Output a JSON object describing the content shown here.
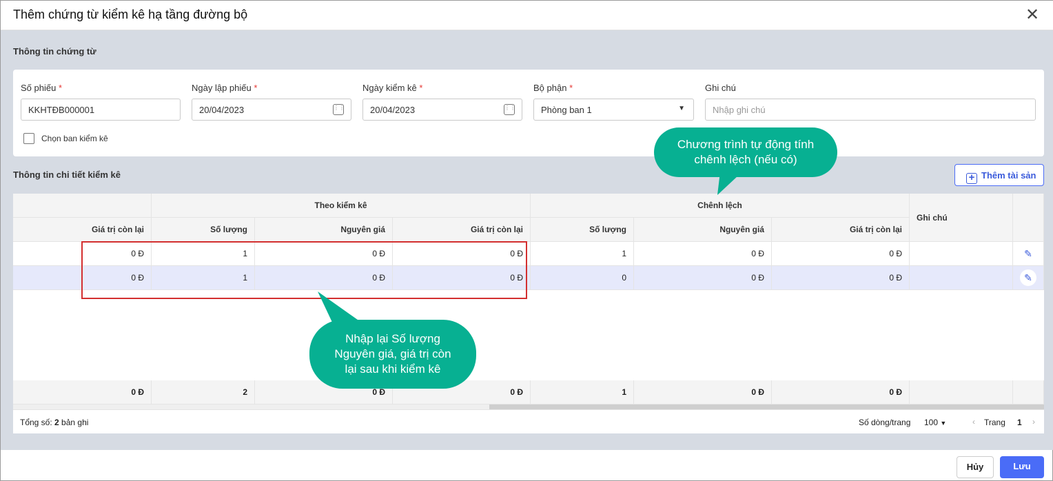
{
  "dialog": {
    "title": "Thêm chứng từ kiểm kê hạ tầng đường bộ"
  },
  "voucher": {
    "section": "Thông tin chứng từ",
    "so_phieu": {
      "label": "Số phiếu",
      "value": "KKHTĐB000001"
    },
    "ngay_lap": {
      "label": "Ngày lập phiếu",
      "value": "20/04/2023"
    },
    "ngay_kiem_ke": {
      "label": "Ngày kiểm kê",
      "value": "20/04/2023"
    },
    "bo_phan": {
      "label": "Bộ phận",
      "value": "Phòng ban 1"
    },
    "ghi_chu": {
      "label": "Ghi chú",
      "placeholder": "Nhập ghi chú"
    },
    "chon_ban": "Chọn ban kiểm kê",
    "required": "*"
  },
  "detail": {
    "section": "Thông tin chi tiết kiểm kê",
    "add_button": "Thêm tài sản",
    "group_headers": [
      "Theo kiểm kê",
      "Chênh lệch"
    ],
    "columns": [
      "Giá trị còn lại",
      "Số lượng",
      "Nguyên giá",
      "Giá trị còn lại",
      "Số lượng",
      "Nguyên giá",
      "Giá trị còn lại",
      "Ghi chú"
    ],
    "rows": [
      [
        "0 Đ",
        "1",
        "0 Đ",
        "0 Đ",
        "1",
        "0 Đ",
        "0 Đ",
        ""
      ],
      [
        "0 Đ",
        "1",
        "0 Đ",
        "0 Đ",
        "0",
        "0 Đ",
        "0 Đ",
        ""
      ]
    ],
    "totals": [
      "0 Đ",
      "2",
      "0 Đ",
      "0 Đ",
      "1",
      "0 Đ",
      "0 Đ",
      ""
    ],
    "footer": {
      "total_prefix": "Tổng số: ",
      "total_count": "2",
      "total_suffix": " bản ghi",
      "page_size_label": "Số dòng/trang",
      "page_size": "100",
      "page_label": "Trang",
      "page": "1"
    }
  },
  "callouts": {
    "top": "Chương trình tự động tính chênh lệch (nếu có)",
    "bottom": "Nhập lại Số lượng Nguyên giá, giá trị còn lại sau khi kiểm kê"
  },
  "actions": {
    "cancel": "Hủy",
    "save": "Lưu"
  }
}
